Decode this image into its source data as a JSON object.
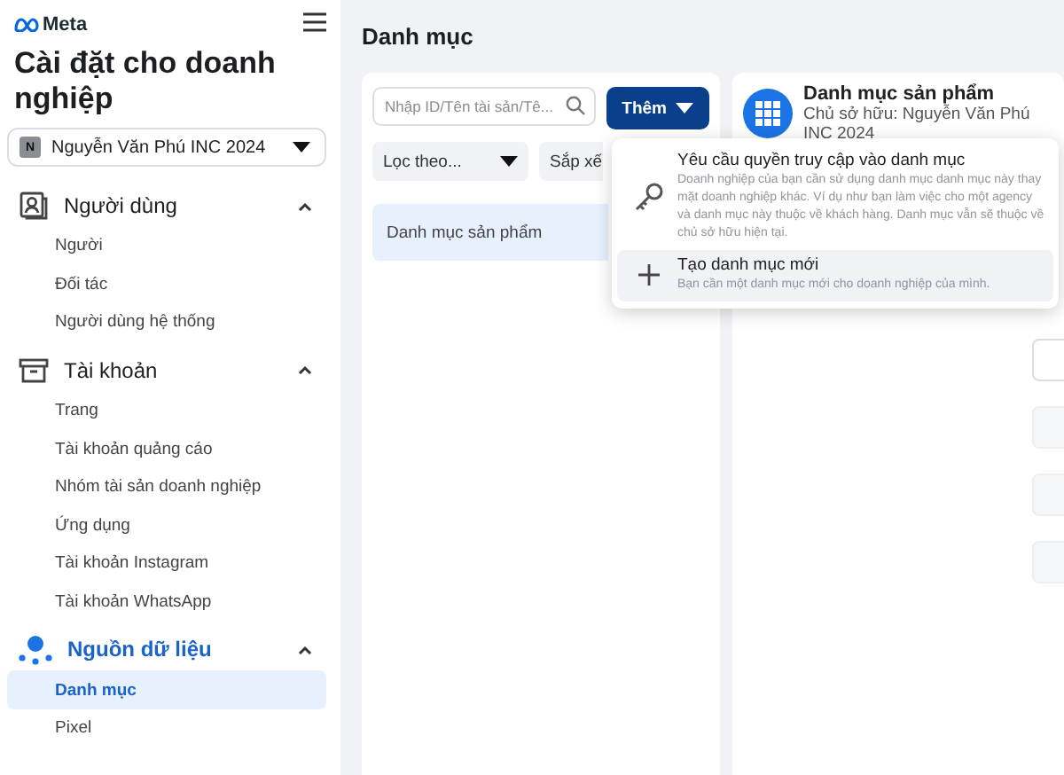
{
  "brand": {
    "name": "Meta"
  },
  "sidebar": {
    "title": "Cài đặt cho doanh nghiệp",
    "account": {
      "initial": "N",
      "name": "Nguyễn Văn Phú INC 2024"
    },
    "sections": [
      {
        "label": "Người dùng",
        "kind": "user",
        "expanded": true,
        "selected": false,
        "items": [
          {
            "label": "Người",
            "selected": false
          },
          {
            "label": "Đối tác",
            "selected": false
          },
          {
            "label": "Người dùng hệ thống",
            "selected": false
          }
        ]
      },
      {
        "label": "Tài khoản",
        "kind": "box",
        "expanded": true,
        "selected": false,
        "items": [
          {
            "label": "Trang",
            "selected": false
          },
          {
            "label": "Tài khoản quảng cáo",
            "selected": false
          },
          {
            "label": "Nhóm tài sản doanh nghiệp",
            "selected": false
          },
          {
            "label": "Ứng dụng",
            "selected": false
          },
          {
            "label": "Tài khoản Instagram",
            "selected": false
          },
          {
            "label": "Tài khoản WhatsApp",
            "selected": false
          }
        ]
      },
      {
        "label": "Nguồn dữ liệu",
        "kind": "data",
        "expanded": true,
        "selected": true,
        "items": [
          {
            "label": "Danh mục",
            "selected": true
          },
          {
            "label": "Pixel",
            "selected": false
          }
        ]
      }
    ]
  },
  "page": {
    "title": "Danh mục"
  },
  "list_panel": {
    "search": {
      "placeholder": "Nhập ID/Tên tài sản/Tê..."
    },
    "add_button": "Thêm",
    "filter": "Lọc theo...",
    "sort": "Sắp xế",
    "rows": [
      {
        "label": "Danh mục sản phẩm",
        "selected": true
      }
    ]
  },
  "detail_panel": {
    "title": "Danh mục sản phẩm",
    "owner": "Chủ sở hữu: Nguyễn Văn Phú INC 2024"
  },
  "add_menu": [
    {
      "kind": "key",
      "title": "Yêu cầu quyền truy cập vào danh mục",
      "description": "Doanh nghiệp của bạn cần sử dụng danh mục danh mục này thay mặt doanh nghiệp khác. Ví dụ như bạn làm việc cho một agency và danh mục này thuộc về khách hàng. Danh mục vẫn sẽ thuộc về chủ sở hữu hiện tại.",
      "selected": false
    },
    {
      "kind": "plus",
      "title": "Tạo danh mục mới",
      "description": "Bạn cần một danh mục mới cho doanh nghiệp của mình.",
      "selected": true
    }
  ]
}
